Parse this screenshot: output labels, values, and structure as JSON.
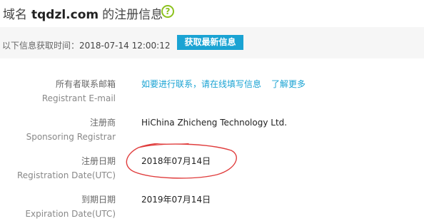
{
  "header": {
    "prefix": "域名",
    "domain": "tqdzl.com",
    "suffix": "的注册信息",
    "help_icon": "question-circle-icon"
  },
  "infobar": {
    "label": "以下信息获取时间：",
    "timestamp": "2018-07-14 12:00:12",
    "button": "获取最新信息"
  },
  "rows": [
    {
      "label_cn": "所有者联系邮箱",
      "label_en": "Registrant E-mail",
      "value": "如要进行联系，请在线填写信息",
      "extra_link": "了解更多"
    },
    {
      "label_cn": "注册商",
      "label_en": "Sponsoring Registrar",
      "value": "HiChina Zhicheng Technology Ltd."
    },
    {
      "label_cn": "注册日期",
      "label_en": "Registration Date(UTC)",
      "value": "2018年07月14日"
    },
    {
      "label_cn": "到期日期",
      "label_en": "Expiration Date(UTC)",
      "value": "2019年07月14日"
    }
  ],
  "colors": {
    "accent": "#1aa3d3",
    "help": "#8dc21f",
    "annotation": "#e03c3c"
  }
}
